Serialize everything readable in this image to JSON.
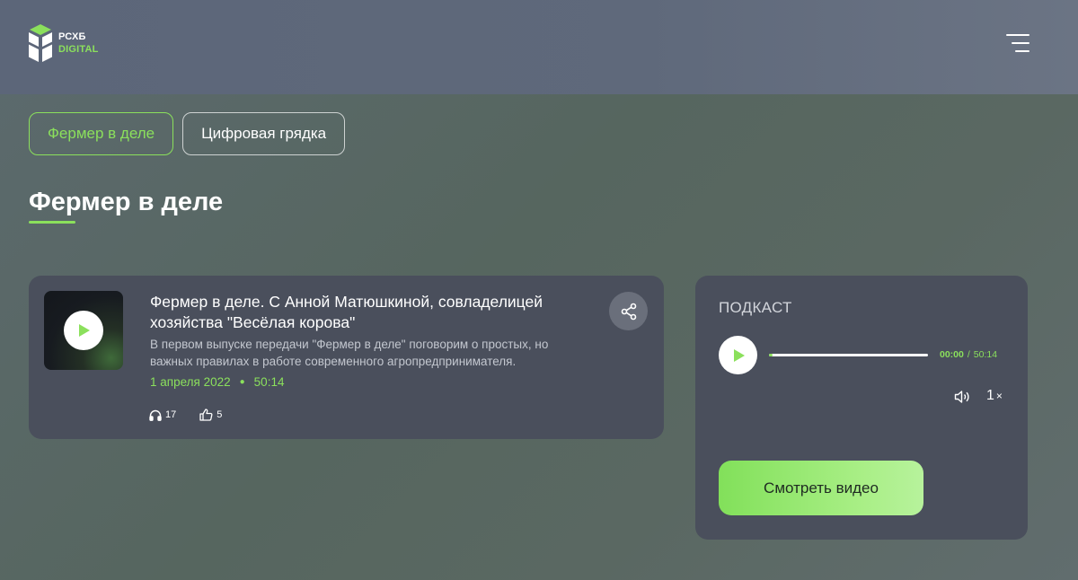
{
  "header": {
    "logo": {
      "line1": "РСХБ",
      "line2": "DIGITAL"
    },
    "menu_icon": "hamburger-menu-icon"
  },
  "tabs": [
    {
      "label": "Фермер в деле",
      "active": true
    },
    {
      "label": "Цифровая грядка",
      "active": false
    }
  ],
  "page": {
    "title": "Фермер в деле"
  },
  "episode": {
    "title": "Фермер в деле. С Анной Матюшкиной, совладелицей хозяйства \"Весёлая корова\"",
    "description": "В первом выпуске передачи \"Фермер в деле\" поговорим о простых, но важных правилах в работе современного агропредпринимателя.",
    "date": "1 апреля 2022",
    "duration": "50:14",
    "listens": "17",
    "likes": "5"
  },
  "player": {
    "label": "ПОДКАСТ",
    "current_time": "00:00",
    "separator": "/",
    "total_time": "50:14",
    "progress": 0.02,
    "speed": "1",
    "speed_suffix": "×",
    "watch_button": "Смотреть видео"
  },
  "colors": {
    "accent": "#8be05c",
    "card_bg": "#4a4f5c",
    "header_bg": "#5f697b"
  }
}
